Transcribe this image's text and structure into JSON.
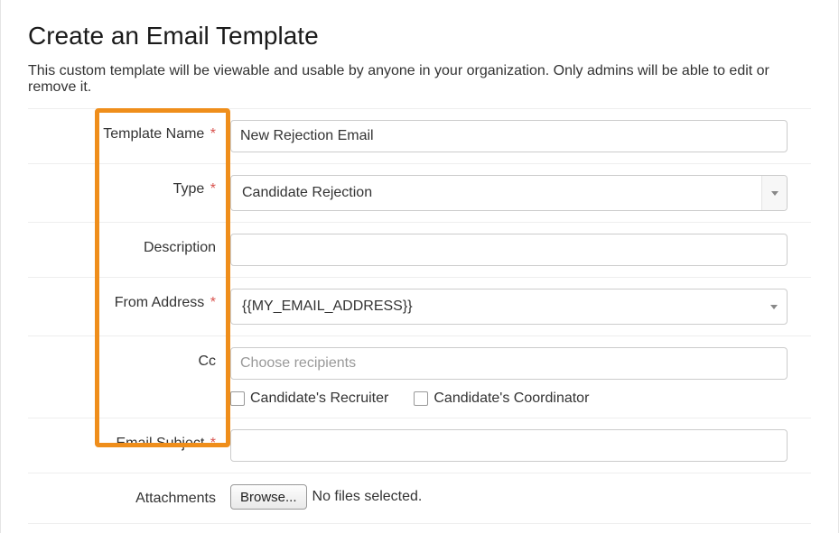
{
  "page": {
    "title": "Create an Email Template",
    "subtitle": "This custom template will be viewable and usable by anyone in your organization. Only admins will be able to edit or remove it."
  },
  "labels": {
    "template_name": "Template Name",
    "type": "Type",
    "description": "Description",
    "from_address": "From Address",
    "cc": "Cc",
    "email_subject": "Email Subject",
    "attachments": "Attachments"
  },
  "required_marker": "*",
  "fields": {
    "template_name": "New Rejection Email",
    "type_selected": "Candidate Rejection",
    "description": "",
    "from_address_selected": "{{MY_EMAIL_ADDRESS}}",
    "cc_placeholder": "Choose recipients",
    "cc_value": "",
    "email_subject": "",
    "attachments_status": "No files selected."
  },
  "checkboxes": {
    "recruiter_label": "Candidate's Recruiter",
    "coordinator_label": "Candidate's Coordinator"
  },
  "buttons": {
    "browse": "Browse..."
  }
}
